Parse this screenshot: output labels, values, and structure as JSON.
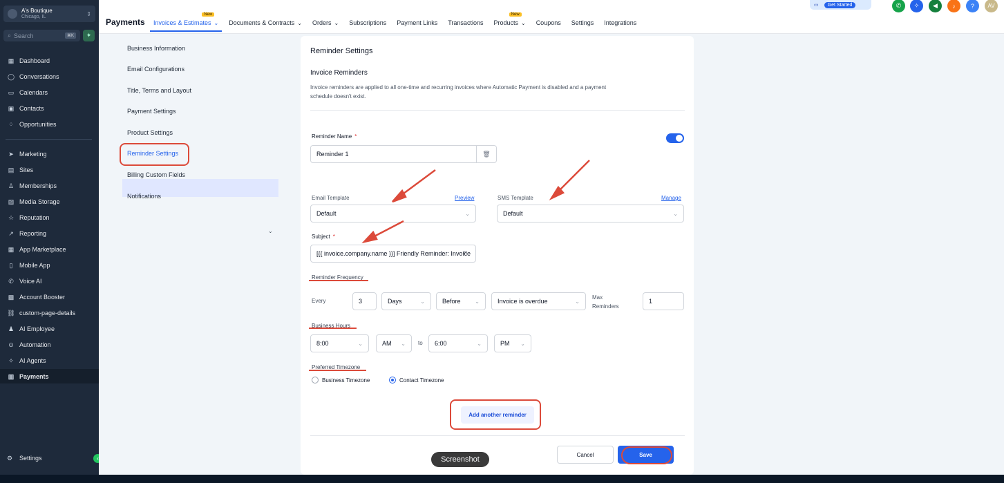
{
  "location": {
    "name": "A's Boutique",
    "city": "Chicago, IL"
  },
  "search": {
    "placeholder": "Search",
    "shortcut": "⌘K"
  },
  "sidebar": {
    "items": [
      {
        "label": "Dashboard",
        "icon": "grid-icon"
      },
      {
        "label": "Conversations",
        "icon": "chat-icon"
      },
      {
        "label": "Calendars",
        "icon": "calendar-icon"
      },
      {
        "label": "Contacts",
        "icon": "contacts-icon"
      },
      {
        "label": "Opportunities",
        "icon": "opportunities-icon"
      },
      {
        "label": "Marketing",
        "icon": "send-icon"
      },
      {
        "label": "Sites",
        "icon": "sites-icon"
      },
      {
        "label": "Memberships",
        "icon": "membership-icon"
      },
      {
        "label": "Media Storage",
        "icon": "image-icon"
      },
      {
        "label": "Reputation",
        "icon": "star-icon"
      },
      {
        "label": "Reporting",
        "icon": "trend-icon"
      },
      {
        "label": "App Marketplace",
        "icon": "apps-icon"
      },
      {
        "label": "Mobile App",
        "icon": "mobile-icon"
      },
      {
        "label": "Voice AI",
        "icon": "phone-icon"
      },
      {
        "label": "Account Booster",
        "icon": "booster-icon"
      },
      {
        "label": "custom-page-details",
        "icon": "link-icon"
      },
      {
        "label": "AI Employee",
        "icon": "person-icon"
      },
      {
        "label": "Automation",
        "icon": "automation-icon"
      },
      {
        "label": "AI Agents",
        "icon": "sparkle-icon"
      },
      {
        "label": "Payments",
        "icon": "receipt-icon"
      }
    ],
    "settings_label": "Settings"
  },
  "header": {
    "title": "Payments",
    "tabs": [
      {
        "label": "Invoices & Estimates",
        "new": "New",
        "chevron": true
      },
      {
        "label": "Documents & Contracts",
        "chevron": true
      },
      {
        "label": "Orders",
        "chevron": true
      },
      {
        "label": "Subscriptions"
      },
      {
        "label": "Payment Links"
      },
      {
        "label": "Transactions"
      },
      {
        "label": "Products",
        "new": "New",
        "chevron": true
      },
      {
        "label": "Coupons"
      },
      {
        "label": "Settings"
      },
      {
        "label": "Integrations"
      }
    ],
    "get_started": "Get Started",
    "avatar_initials": "AV",
    "help": "?"
  },
  "submenu": {
    "items": [
      "Business Information",
      "Email Configurations",
      "Title, Terms and Layout",
      "Payment Settings",
      "Product Settings",
      "Reminder Settings",
      "Billing Custom Fields",
      "Notifications"
    ]
  },
  "reminder": {
    "title": "Reminder Settings",
    "section_title": "Invoice Reminders",
    "section_desc": "Invoice reminders are applied to all one-time and recurring invoices where Automatic Payment is disabled and a payment schedule doesn't exist.",
    "name_label": "Reminder Name",
    "required_mark": "*",
    "name_value": "Reminder 1",
    "email_template_label": "Email Template",
    "preview_link": "Preview",
    "email_template_value": "Default",
    "sms_template_label": "SMS Template",
    "manage_link": "Manage",
    "sms_template_value": "Default",
    "subject_label": "Subject",
    "subject_value": "[{{ invoice.company.name }}] Friendly Reminder: Invoice",
    "frequency_label": "Reminder Frequency",
    "every_label": "Every",
    "every_value": "3",
    "unit_value": "Days",
    "timing_value": "Before",
    "event_value": "Invoice is overdue",
    "max_label_1": "Max",
    "max_label_2": "Reminders",
    "max_value": "1",
    "hours_label": "Business Hours",
    "hours_from": "8:00",
    "hours_from_ampm": "AM",
    "to_label": "to",
    "hours_to": "6:00",
    "hours_to_ampm": "PM",
    "timezone_label": "Preferred Timezone",
    "tz_business": "Business Timezone",
    "tz_contact": "Contact Timezone",
    "tz_selected": "Contact Timezone",
    "add_label": "Add another reminder",
    "cancel_label": "Cancel",
    "save_label": "Save"
  },
  "tooltip": "Screenshot",
  "colors": {
    "accent": "#2563eb",
    "annotation": "#dc4a3a",
    "sidebar": "#1e2a3b"
  }
}
